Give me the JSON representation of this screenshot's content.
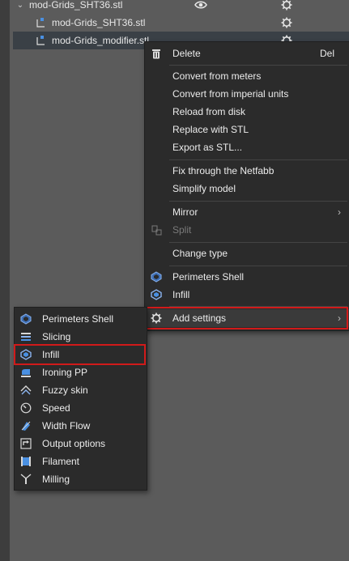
{
  "tree": {
    "items": [
      {
        "label": "mod-Grids_SHT36.stl",
        "level": 0,
        "expanded": true,
        "visible_icon": "eye-icon",
        "settings_icon": "gear-icon"
      },
      {
        "label": "mod-Grids_SHT36.stl",
        "level": 1,
        "icon": "part-icon",
        "settings_icon": "gear-icon"
      },
      {
        "label": "mod-Grids_modifier.stl",
        "level": 1,
        "icon": "modifier-icon",
        "settings_icon": "gear-icon",
        "selected": true
      }
    ]
  },
  "context_menu": {
    "items": [
      {
        "label": "Delete",
        "shortcut": "Del",
        "icon": "trash-icon"
      },
      {
        "label": "Convert from meters"
      },
      {
        "label": "Convert from imperial units"
      },
      {
        "label": "Reload from disk"
      },
      {
        "label": "Replace with STL"
      },
      {
        "label": "Export as STL..."
      },
      {
        "label": "Fix through the Netfabb"
      },
      {
        "label": "Simplify model"
      },
      {
        "label": "Mirror",
        "submenu": true
      },
      {
        "label": "Split",
        "disabled": true,
        "icon": "split-icon"
      },
      {
        "label": "Change type"
      },
      {
        "label": "Perimeters  Shell",
        "icon": "perimeters-icon"
      },
      {
        "label": "Infill",
        "icon": "infill-icon"
      },
      {
        "label": "Add settings",
        "icon": "gear-icon",
        "submenu": true,
        "highlighted": true
      }
    ]
  },
  "add_settings_submenu": {
    "items": [
      {
        "label": "Perimeters  Shell",
        "icon": "perimeters-icon"
      },
      {
        "label": "Slicing",
        "icon": "slicing-icon"
      },
      {
        "label": "Infill",
        "icon": "infill-icon",
        "highlighted": true
      },
      {
        "label": "Ironing PP",
        "icon": "ironing-icon"
      },
      {
        "label": "Fuzzy skin",
        "icon": "fuzzy-skin-icon"
      },
      {
        "label": "Speed",
        "icon": "speed-icon"
      },
      {
        "label": "Width  Flow",
        "icon": "width-flow-icon"
      },
      {
        "label": "Output options",
        "icon": "output-options-icon"
      },
      {
        "label": "Filament",
        "icon": "filament-icon"
      },
      {
        "label": "Milling",
        "icon": "milling-icon"
      }
    ]
  },
  "colors": {
    "background": "#5b5b5b",
    "menu_bg": "#2b2b2b",
    "highlight_box": "#d11a1a",
    "accent_blue": "#4a90e2"
  }
}
